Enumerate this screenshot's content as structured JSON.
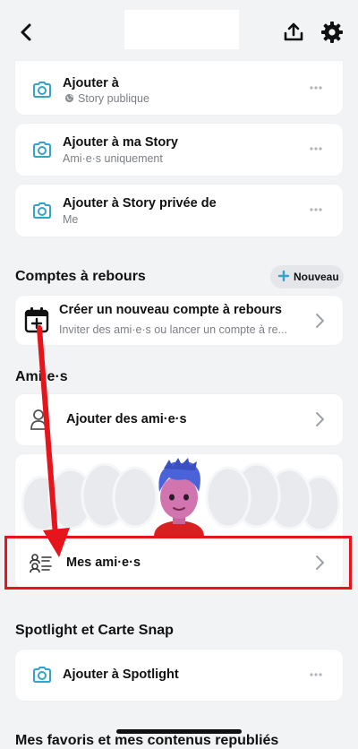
{
  "topbar": {
    "title": ""
  },
  "stories": [
    {
      "title": "Ajouter à",
      "subtitle": "Story publique"
    },
    {
      "title": "Ajouter à ma Story",
      "subtitle": "Ami·e·s uniquement"
    },
    {
      "title": "Ajouter à Story privée de",
      "subtitle": "Me"
    }
  ],
  "countdowns": {
    "section_title": "Comptes à rebours",
    "new_label": "Nouveau",
    "item_title": "Créer un nouveau compte à rebours",
    "item_subtitle": "Inviter des ami·e·s ou lancer un compte à re..."
  },
  "friends": {
    "section_title": "Ami·e·s",
    "add_label": "Ajouter des ami·e·s",
    "my_friends_label": "Mes ami·e·s"
  },
  "spotlight": {
    "section_title": "Spotlight et Carte Snap",
    "add_label": "Ajouter à Spotlight"
  },
  "favorites": {
    "section_title": "Mes favoris et mes contenus republiés"
  },
  "colors": {
    "accent": "#35a2c7",
    "highlight": "#e8141b",
    "background": "#f2f3f5"
  }
}
